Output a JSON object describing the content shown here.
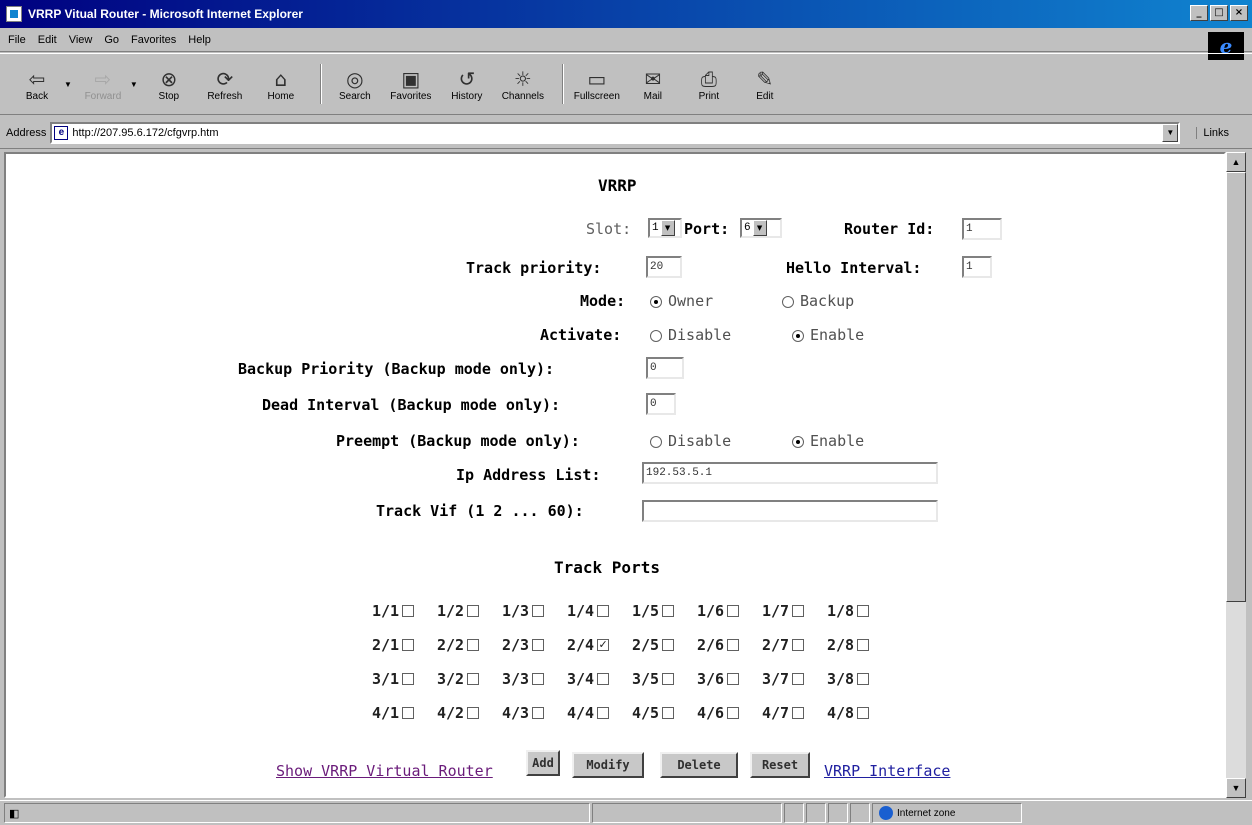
{
  "window": {
    "title": "VRRP Vitual Router - Microsoft Internet Explorer",
    "controls": [
      "_",
      "□",
      "×"
    ]
  },
  "menu": [
    "File",
    "Edit",
    "View",
    "Go",
    "Favorites",
    "Help"
  ],
  "toolbar": {
    "back": "Back",
    "forward": "Forward",
    "stop": "Stop",
    "refresh": "Refresh",
    "home": "Home",
    "search": "Search",
    "favorites": "Favorites",
    "history": "History",
    "channels": "Channels",
    "fullscreen": "Fullscreen",
    "mail": "Mail",
    "print": "Print",
    "edit": "Edit"
  },
  "address": {
    "label": "Address",
    "url": "http://207.95.6.172/cfgvrp.htm",
    "links": "Links"
  },
  "page": {
    "heading": "VRRP",
    "slot_label": "Slot:",
    "slot_value": "1",
    "port_label": "Port:",
    "port_value": "6",
    "router_id_label": "Router Id:",
    "router_id_value": "1",
    "track_priority_label": "Track priority:",
    "track_priority_value": "20",
    "hello_interval_label": "Hello Interval:",
    "hello_interval_value": "1",
    "mode_label": "Mode:",
    "mode_owner": "Owner",
    "mode_backup": "Backup",
    "activate_label": "Activate:",
    "activate_disable": "Disable",
    "activate_enable": "Enable",
    "backup_priority_label": "Backup Priority (Backup mode only):",
    "backup_priority_value": "0",
    "dead_interval_label": "Dead Interval (Backup mode only):",
    "dead_interval_value": "0",
    "preempt_label": "Preempt (Backup mode only):",
    "preempt_disable": "Disable",
    "preempt_enable": "Enable",
    "ip_list_label": "Ip Address List:",
    "ip_list_value": "192.53.5.1",
    "track_vif_label": "Track Vif (1 2 ... 60):",
    "track_vif_value": "",
    "track_ports_heading": "Track Ports",
    "track_ports": [
      [
        "1/1",
        "1/2",
        "1/3",
        "1/4",
        "1/5",
        "1/6",
        "1/7",
        "1/8"
      ],
      [
        "2/1",
        "2/2",
        "2/3",
        "2/4",
        "2/5",
        "2/6",
        "2/7",
        "2/8"
      ],
      [
        "3/1",
        "3/2",
        "3/3",
        "3/4",
        "3/5",
        "3/6",
        "3/7",
        "3/8"
      ],
      [
        "4/1",
        "4/2",
        "4/3",
        "4/4",
        "4/5",
        "4/6",
        "4/7",
        "4/8"
      ]
    ],
    "checked_ports": [
      "2/4"
    ],
    "show_link": "Show VRRP Virtual Router",
    "add_button": "Add",
    "modify_button": "Modify",
    "delete_button": "Delete",
    "reset_button": "Reset",
    "interface_link": "VRRP Interface"
  },
  "status": {
    "zone": "Internet zone"
  }
}
